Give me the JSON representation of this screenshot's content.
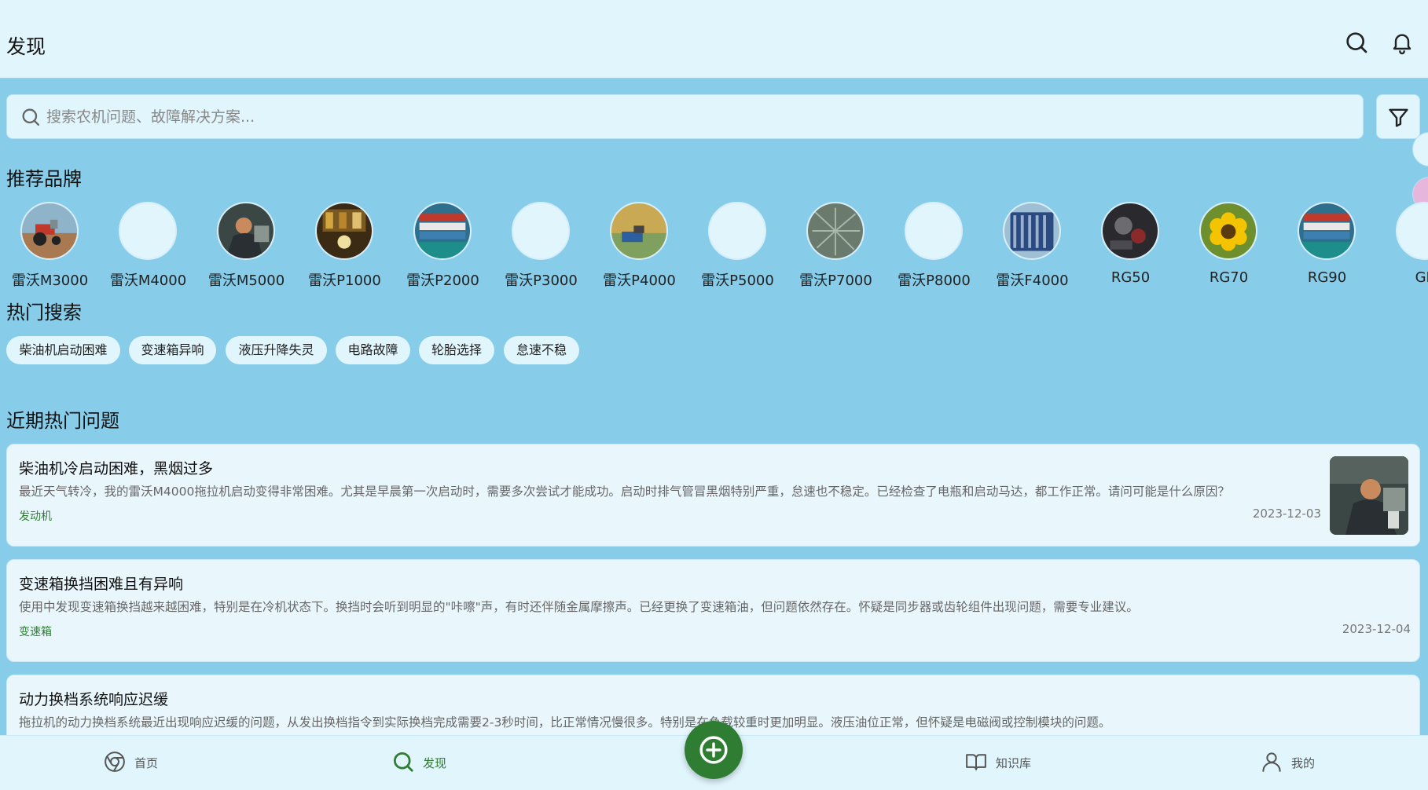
{
  "header": {
    "title": "发现"
  },
  "search": {
    "placeholder": "搜索农机问题、故障解决方案..."
  },
  "sections": {
    "brands_title": "推荐品牌",
    "hot_search_title": "热门搜索",
    "recent_title": "近期热门问题"
  },
  "brands": [
    {
      "label": "雷沃M3000",
      "image": "tractor-field"
    },
    {
      "label": "雷沃M4000",
      "image": "none"
    },
    {
      "label": "雷沃M5000",
      "image": "mechanic"
    },
    {
      "label": "雷沃P1000",
      "image": "workshop"
    },
    {
      "label": "雷沃P2000",
      "image": "port-cargo"
    },
    {
      "label": "雷沃P3000",
      "image": "none"
    },
    {
      "label": "雷沃P4000",
      "image": "harvest-field"
    },
    {
      "label": "雷沃P5000",
      "image": "none"
    },
    {
      "label": "雷沃P7000",
      "image": "plant"
    },
    {
      "label": "雷沃P8000",
      "image": "none"
    },
    {
      "label": "雷沃F4000",
      "image": "building"
    },
    {
      "label": "RG50",
      "image": "engine"
    },
    {
      "label": "RG70",
      "image": "sunflower"
    },
    {
      "label": "RG90",
      "image": "port-cargo"
    },
    {
      "label": "GK",
      "image": "none"
    }
  ],
  "hot_searches": [
    "柴油机启动困难",
    "变速箱异响",
    "液压升降失灵",
    "电路故障",
    "轮胎选择",
    "怠速不稳"
  ],
  "questions": [
    {
      "title": "柴油机冷启动困难，黑烟过多",
      "desc": "最近天气转冷，我的雷沃M4000拖拉机启动变得非常困难。尤其是早晨第一次启动时，需要多次尝试才能成功。启动时排气管冒黑烟特别严重，怠速也不稳定。已经检查了电瓶和启动马达，都工作正常。请问可能是什么原因？",
      "tag": "发动机",
      "date": "2023-12-03",
      "thumbnail": "mechanic"
    },
    {
      "title": "变速箱换挡困难且有异响",
      "desc": "使用中发现变速箱换挡越来越困难，特别是在冷机状态下。换挡时会听到明显的\"咔嚓\"声，有时还伴随金属摩擦声。已经更换了变速箱油，但问题依然存在。怀疑是同步器或齿轮组件出现问题，需要专业建议。",
      "tag": "变速箱",
      "date": "2023-12-04"
    },
    {
      "title": "动力换档系统响应迟缓",
      "desc": "拖拉机的动力换档系统最近出现响应迟缓的问题，从发出换档指令到实际换档完成需要2-3秒时间，比正常情况慢很多。特别是在负载较重时更加明显。液压油位正常，但怀疑是电磁阀或控制模块的问题。"
    }
  ],
  "nav": {
    "home": "首页",
    "discover": "发现",
    "knowledge": "知识库",
    "mine": "我的"
  },
  "colors": {
    "background": "#87cdea",
    "surface": "#e1f5fd",
    "accent": "#2e7d32"
  }
}
